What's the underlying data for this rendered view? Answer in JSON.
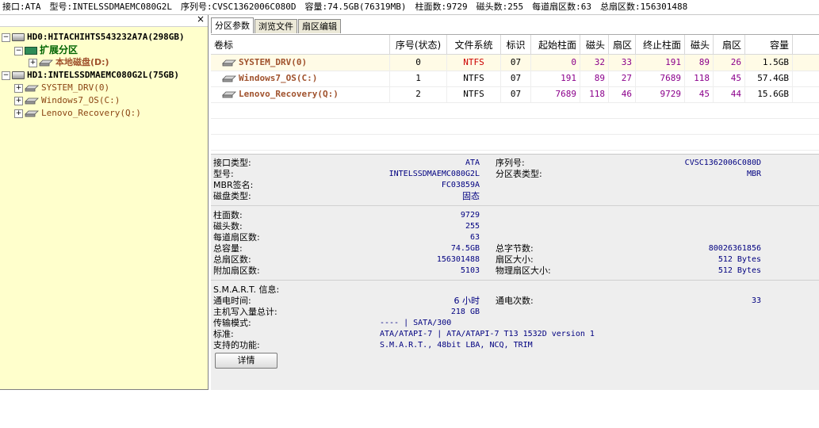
{
  "topbar": {
    "interface": "接口:ATA",
    "model": "型号:INTELSSDMAEMC080G2L",
    "serial": "序列号:CVSC1362006C080D",
    "capacity": "容量:74.5GB(76319MB)",
    "cylinders": "柱面数:9729",
    "heads": "磁头数:255",
    "sectors_per_track": "每道扇区数:63",
    "total_sectors": "总扇区数:156301488"
  },
  "tree": {
    "close_glyph": "×",
    "hd0": "HD0:HITACHIHTS543232A7A(298GB)",
    "extended": "扩展分区",
    "local_disk": "本地磁盘(D:)",
    "hd1": "HD1:INTELSSDMAEMC080G2L(75GB)",
    "system_drv": "SYSTEM_DRV(0)",
    "windows7": "Windows7_OS(C:)",
    "lenovo": "Lenovo_Recovery(Q:)"
  },
  "tabs": [
    "分区参数",
    "浏览文件",
    "扇区编辑"
  ],
  "grid": {
    "headers": [
      "卷标",
      "序号(状态)",
      "文件系统",
      "标识",
      "起始柱面",
      "磁头",
      "扇区",
      "终止柱面",
      "磁头",
      "扇区",
      "容量"
    ],
    "rows": [
      {
        "name": "SYSTEM_DRV(0)",
        "index": "0",
        "fs": "NTFS",
        "id": "07",
        "start_cyl": "0",
        "start_head": "32",
        "start_sec": "33",
        "end_cyl": "191",
        "end_head": "89",
        "end_sec": "26",
        "size": "1.5GB"
      },
      {
        "name": "Windows7_OS(C:)",
        "index": "1",
        "fs": "NTFS",
        "id": "07",
        "start_cyl": "191",
        "start_head": "89",
        "start_sec": "27",
        "end_cyl": "7689",
        "end_head": "118",
        "end_sec": "45",
        "size": "57.4GB"
      },
      {
        "name": "Lenovo_Recovery(Q:)",
        "index": "2",
        "fs": "NTFS",
        "id": "07",
        "start_cyl": "7689",
        "start_head": "118",
        "start_sec": "46",
        "end_cyl": "9729",
        "end_head": "45",
        "end_sec": "44",
        "size": "15.6GB"
      }
    ]
  },
  "info": {
    "interface_type_label": "接口类型:",
    "interface_type": "ATA",
    "serial_label": "序列号:",
    "serial": "CVSC1362006C080D",
    "model_label": "型号:",
    "model": "INTELSSDMAEMC080G2L",
    "ptable_label": "分区表类型:",
    "ptable": "MBR",
    "mbr_sig_label": "MBR签名:",
    "mbr_sig": "FC03859A",
    "disk_type_label": "磁盘类型:",
    "disk_type": "固态",
    "cylinders_label": "柱面数:",
    "cylinders": "9729",
    "heads_label": "磁头数:",
    "heads": "255",
    "spt_label": "每道扇区数:",
    "spt": "63",
    "total_cap_label": "总容量:",
    "total_cap": "74.5GB",
    "total_bytes_label": "总字节数:",
    "total_bytes": "80026361856",
    "total_sectors_label": "总扇区数:",
    "total_sectors": "156301488",
    "sector_size_label": "扇区大小:",
    "sector_size": "512 Bytes",
    "extra_sectors_label": "附加扇区数:",
    "extra_sectors": "5103",
    "phys_sector_label": "物理扇区大小:",
    "phys_sector": "512 Bytes",
    "smart_label": "S.M.A.R.T. 信息:",
    "power_on_label": "通电时间:",
    "power_on": "6 小时",
    "power_count_label": "通电次数:",
    "power_count": "33",
    "host_writes_label": "主机写入量总计:",
    "host_writes": "218 GB",
    "transfer_label": "传输模式:",
    "transfer": "---- | SATA/300",
    "standard_label": "标准:",
    "standard": "ATA/ATAPI-7 | ATA/ATAPI-7 T13 1532D version 1",
    "features_label": "支持的功能:",
    "features": "S.M.A.R.T., 48bit LBA, NCQ, TRIM",
    "detail_button": "详情"
  }
}
